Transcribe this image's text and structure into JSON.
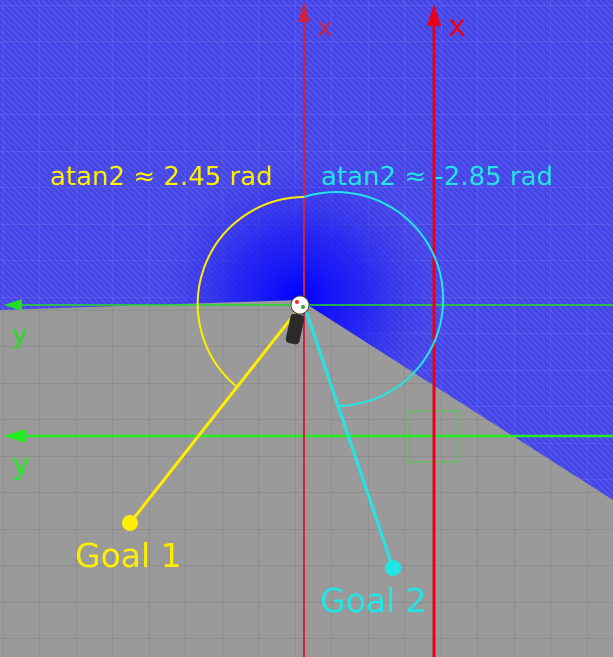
{
  "colors": {
    "floor": "#9a9a9a",
    "floor_grid": "#7f7f7f",
    "field": "#3a3ae6",
    "field_core": "#0000ff",
    "x_axis_primary": "#cc2244",
    "x_axis_secondary": "#e8001a",
    "y_axis": "#22dd22",
    "goal1": "#ffee00",
    "goal2": "#22e5e5",
    "robot_body": "#ffffff",
    "robot_shadow": "#2a2a2a"
  },
  "axes": {
    "x_label_1": "x",
    "x_label_2": "x",
    "y_label_1": "y",
    "y_label_2": "y"
  },
  "goals": [
    {
      "label": "Goal 1",
      "angle_text": "atan2 ≈ 2.45 rad",
      "angle_rad": 2.45
    },
    {
      "label": "Goal 2",
      "angle_text": "atan2 ≈ -2.85 rad",
      "angle_rad": -2.85
    }
  ],
  "icons": {
    "robot": "robot-icon",
    "goal_marker": "goal-dot-icon",
    "axis_arrow": "arrow-head-icon"
  }
}
